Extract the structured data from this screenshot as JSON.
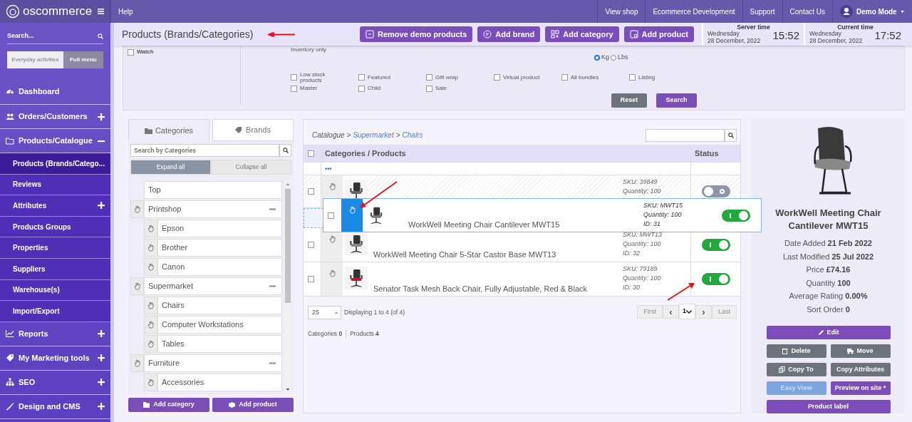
{
  "topbar": {
    "logo": "oscommerce",
    "help": "Help",
    "links": [
      "View shop",
      "Ecommerce Development",
      "Support",
      "Contact Us"
    ],
    "user": "Demo Mode"
  },
  "sidebar": {
    "search_placeholder": "Search...",
    "modes": [
      {
        "label": "Everyday activities",
        "selected": false
      },
      {
        "label": "Full menu",
        "selected": true
      }
    ],
    "items": [
      {
        "label": "Dashboard",
        "kind": "group",
        "selected": false
      },
      {
        "label": "Orders/Customers",
        "kind": "group",
        "expanded": false,
        "selected": false
      },
      {
        "label": "Products/Catalogue",
        "kind": "group",
        "expanded": true,
        "selected": false
      },
      {
        "label": "Products (Brands/Catego...",
        "kind": "subitem",
        "selected": true
      },
      {
        "label": "Reviews",
        "kind": "subitem",
        "selected": false
      },
      {
        "label": "Attributes",
        "kind": "subitem",
        "expanded": false,
        "selected": false
      },
      {
        "label": "Products Groups",
        "kind": "subitem",
        "selected": false
      },
      {
        "label": "Properties",
        "kind": "subitem",
        "selected": false
      },
      {
        "label": "Suppliers",
        "kind": "subitem",
        "selected": false
      },
      {
        "label": "Warehouse(s)",
        "kind": "subitem",
        "selected": false
      },
      {
        "label": "Import/Export",
        "kind": "subitem",
        "selected": false
      },
      {
        "label": "Reports",
        "kind": "group",
        "expanded": false,
        "selected": false
      },
      {
        "label": "My Marketing tools",
        "kind": "group",
        "expanded": false,
        "selected": false
      },
      {
        "label": "SEO",
        "kind": "group",
        "expanded": false,
        "selected": false
      },
      {
        "label": "Design and CMS",
        "kind": "group",
        "expanded": false,
        "selected": false
      }
    ]
  },
  "header": {
    "title": "Products (Brands/Categories)",
    "actions": [
      "Remove demo products",
      "Add brand",
      "Add category",
      "Add product"
    ],
    "clocks": [
      {
        "label": "Server time",
        "day": "Wednesday",
        "date": "28 December, 2022",
        "time": "15:52"
      },
      {
        "label": "Current time",
        "day": "Wednesday",
        "date": "28 December, 2022",
        "time": "17:52"
      }
    ]
  },
  "filters": {
    "watch": {
      "label": "Watch",
      "checked": false
    },
    "inventory_label": "Inventory only",
    "weight": [
      {
        "label": "Kg",
        "selected": true
      },
      {
        "label": "Lbs",
        "selected": false
      }
    ],
    "checkboxes": [
      {
        "label": "Low stock products",
        "checked": false
      },
      {
        "label": "Featured",
        "checked": false
      },
      {
        "label": "Gift wrap",
        "checked": false
      },
      {
        "label": "Virtual product",
        "checked": false
      },
      {
        "label": "All bundles",
        "checked": false
      },
      {
        "label": "Listing",
        "checked": false
      },
      {
        "label": "Master",
        "checked": false
      },
      {
        "label": "Child",
        "checked": false
      },
      {
        "label": "Sale",
        "checked": false
      }
    ],
    "buttons": [
      "Reset",
      "Search"
    ]
  },
  "categories_panel": {
    "tabs": [
      {
        "label": "Categories",
        "selected": true
      },
      {
        "label": "Brands",
        "selected": false
      }
    ],
    "search_placeholder": "Search by Categories",
    "expand_buttons": [
      {
        "label": "Expand all",
        "selected": true
      },
      {
        "label": "Collapse all",
        "selected": false
      }
    ],
    "tree": [
      {
        "label": "Top",
        "draggable": false
      },
      {
        "label": "Printshop",
        "draggable": true,
        "expanded": true,
        "children": [
          {
            "label": "Epson",
            "draggable": true
          },
          {
            "label": "Brother",
            "draggable": true
          },
          {
            "label": "Canon",
            "draggable": true
          }
        ]
      },
      {
        "label": "Supermarket",
        "draggable": true,
        "expanded": true,
        "children": [
          {
            "label": "Chairs",
            "draggable": true
          },
          {
            "label": "Computer Workstations",
            "draggable": true
          },
          {
            "label": "Tables",
            "draggable": true
          }
        ]
      },
      {
        "label": "Furniture",
        "draggable": true,
        "expanded": true,
        "children": [
          {
            "label": "Accessories",
            "draggable": true
          }
        ]
      }
    ],
    "buttons": [
      "Add category",
      "Add product"
    ]
  },
  "listing": {
    "breadcrumb": [
      {
        "label": "Catalogue",
        "link": false
      },
      {
        "label": "Supermarket",
        "link": true
      },
      {
        "label": "Chairs",
        "link": true
      }
    ],
    "separator": ">",
    "columns": [
      "Categories / Products",
      "Status"
    ],
    "select_all_checked": false,
    "more": "•••",
    "rows": [
      {
        "kind": "product",
        "checked": false,
        "sku": "SKU: 39849",
        "quantity": "Quantity: 100",
        "status_on": false
      },
      {
        "kind": "placeholder"
      },
      {
        "kind": "product",
        "checked": false,
        "name": "WorkWell Meeting Chair 5-Star Castor Base MWT13",
        "sku": "SKU: MWT13",
        "quantity": "Quantity: 100",
        "id": "ID: 32",
        "status_on": true
      },
      {
        "kind": "product",
        "checked": false,
        "name": "Senator Task Mesh Back Chair, Fully Adjustable, Red & Black",
        "sku": "SKU: 79189",
        "quantity": "Quantity: 100",
        "id": "ID: 30",
        "status_on": true
      }
    ],
    "dragged_row": {
      "checked": false,
      "name": "WorkWell Meeting Chair Cantilever MWT15",
      "sku": "SKU: MWT15",
      "quantity": "Quantity: 100",
      "id": "ID: 31",
      "status_on": true
    },
    "per_page": "25",
    "displaying": "Displaying 1 to 4 (of 4)",
    "pager": [
      {
        "label": "First",
        "kind": "text",
        "disabled": true
      },
      {
        "label": "‹",
        "kind": "arrow",
        "disabled": false
      },
      {
        "label": "1",
        "kind": "page",
        "disabled": false
      },
      {
        "label": "›",
        "kind": "arrow",
        "disabled": false
      },
      {
        "label": "Last",
        "kind": "text",
        "disabled": true
      }
    ],
    "counts": [
      {
        "label": "Categories",
        "value": "0"
      },
      {
        "label": "Products",
        "value": "4"
      }
    ]
  },
  "details": {
    "name": "WorkWell Meeting Chair Cantilever MWT15",
    "fields": [
      {
        "label": "Date Added",
        "value": "21 Feb 2022"
      },
      {
        "label": "Last Modified",
        "value": "25 Jul 2022"
      },
      {
        "label": "Price",
        "value": "£74.16"
      },
      {
        "label": "Quantity",
        "value": "100"
      },
      {
        "label": "Average Rating",
        "value": "0.00%"
      },
      {
        "label": "Sort Order",
        "value": "0"
      }
    ],
    "buttons": [
      {
        "label": "Edit",
        "kind": "primary",
        "wide": true
      },
      {
        "label": "Delete",
        "kind": "secondary",
        "wide": false
      },
      {
        "label": "Move",
        "kind": "secondary",
        "wide": false
      },
      {
        "label": "Copy To",
        "kind": "secondary",
        "wide": false
      },
      {
        "label": "Copy Attributes",
        "kind": "secondary",
        "wide": false
      },
      {
        "label": "Easy View",
        "kind": "disabled",
        "wide": false
      },
      {
        "label": "Preview on site *",
        "kind": "primary",
        "wide": false
      },
      {
        "label": "Product label",
        "kind": "primary",
        "wide": true
      }
    ]
  }
}
